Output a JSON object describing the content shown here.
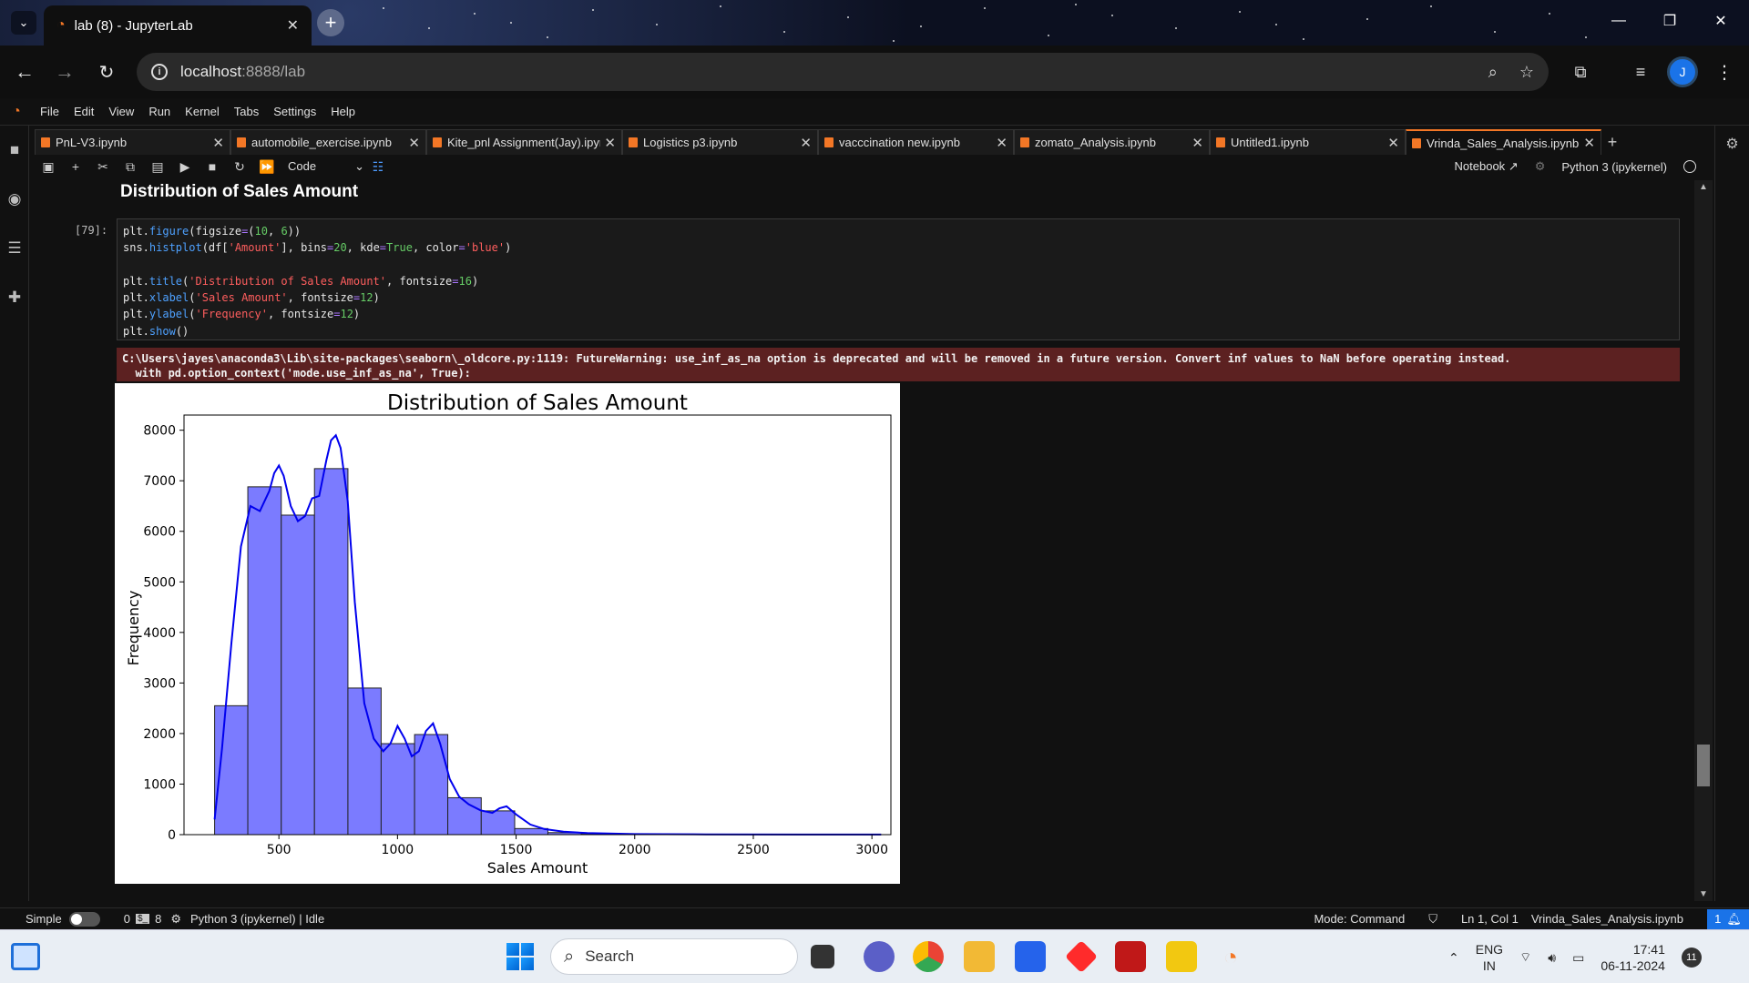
{
  "browser": {
    "tab_title": "lab (8) - JupyterLab",
    "url_host": "localhost",
    "url_rest": ":8888/lab",
    "profile_initial": "J"
  },
  "menu": [
    "File",
    "Edit",
    "View",
    "Run",
    "Kernel",
    "Tabs",
    "Settings",
    "Help"
  ],
  "notebook_tabs": [
    {
      "name": "PnL-V3.ipynb",
      "active": false
    },
    {
      "name": "automobile_exercise.ipynb",
      "active": false
    },
    {
      "name": "Kite_pnl Assignment(Jay).ipyn",
      "active": false
    },
    {
      "name": "Logistics p3.ipynb",
      "active": false
    },
    {
      "name": "vacccination new.ipynb",
      "active": false
    },
    {
      "name": "zomato_Analysis.ipynb",
      "active": false
    },
    {
      "name": "Untitled1.ipynb",
      "active": false
    },
    {
      "name": "Vrinda_Sales_Analysis.ipynb",
      "active": true
    }
  ],
  "toolbar": {
    "cell_type": "Code",
    "notebook_label": "Notebook",
    "kernel_label": "Python 3 (ipykernel)"
  },
  "cell": {
    "heading": "Distribution of Sales Amount",
    "prompt": "[79]:",
    "warning_line1": "C:\\Users\\jayes\\anaconda3\\Lib\\site-packages\\seaborn\\_oldcore.py:1119: FutureWarning: use_inf_as_na option is deprecated and will be removed in a future version. Convert inf values to NaN before operating instead.",
    "warning_line2": "  with pd.option_context('mode.use_inf_as_na', True):"
  },
  "chart_data": {
    "type": "bar",
    "title": "Distribution of Sales Amount",
    "xlabel": "Sales Amount",
    "ylabel": "Frequency",
    "xlim": [
      100,
      3080
    ],
    "ylim": [
      0,
      8300
    ],
    "xticks": [
      500,
      1000,
      1500,
      2000,
      2500,
      3000
    ],
    "yticks": [
      0,
      1000,
      2000,
      3000,
      4000,
      5000,
      6000,
      7000,
      8000
    ],
    "bin_edges": [
      229,
      369,
      510,
      650,
      791,
      931,
      1072,
      1212,
      1353,
      1494,
      1634,
      1775,
      1915,
      2056,
      2196,
      2337,
      2477,
      2618,
      2758,
      2899,
      3039
    ],
    "values": [
      2550,
      6880,
      6320,
      7240,
      2900,
      1800,
      1980,
      730,
      470,
      120,
      40,
      20,
      10,
      5,
      3,
      2,
      1,
      1,
      1,
      1
    ],
    "kde_x": [
      229,
      260,
      300,
      340,
      380,
      420,
      460,
      480,
      500,
      520,
      550,
      580,
      610,
      640,
      670,
      700,
      720,
      740,
      760,
      790,
      820,
      860,
      900,
      940,
      970,
      1000,
      1030,
      1060,
      1090,
      1120,
      1150,
      1180,
      1220,
      1260,
      1300,
      1350,
      1400,
      1430,
      1460,
      1500,
      1560,
      1620,
      1700,
      1800,
      2000,
      2300,
      2700,
      3039
    ],
    "kde_y": [
      300,
      1700,
      3800,
      5700,
      6500,
      6400,
      6800,
      7150,
      7300,
      7100,
      6500,
      6200,
      6300,
      6650,
      6700,
      7400,
      7800,
      7900,
      7650,
      6600,
      4600,
      2600,
      1900,
      1650,
      1800,
      2150,
      1900,
      1550,
      1650,
      2050,
      2200,
      1800,
      1100,
      750,
      600,
      480,
      430,
      520,
      560,
      400,
      200,
      110,
      60,
      30,
      10,
      5,
      2,
      1
    ],
    "bar_color": "#7b7bff",
    "line_color": "#0000ee",
    "grid": false
  },
  "status": {
    "mode_toggle_label": "Simple",
    "terminals": "0",
    "kernels": "8",
    "kernel_state": "Python 3 (ipykernel) | Idle",
    "mode": "Mode: Command",
    "cursor": "Ln 1, Col 1",
    "file": "Vrinda_Sales_Analysis.ipynb",
    "notifications": "1"
  },
  "taskbar": {
    "search_placeholder": "Search",
    "lang_top": "ENG",
    "lang_bottom": "IN",
    "time": "17:41",
    "date": "06-11-2024",
    "notif_count": "11"
  }
}
